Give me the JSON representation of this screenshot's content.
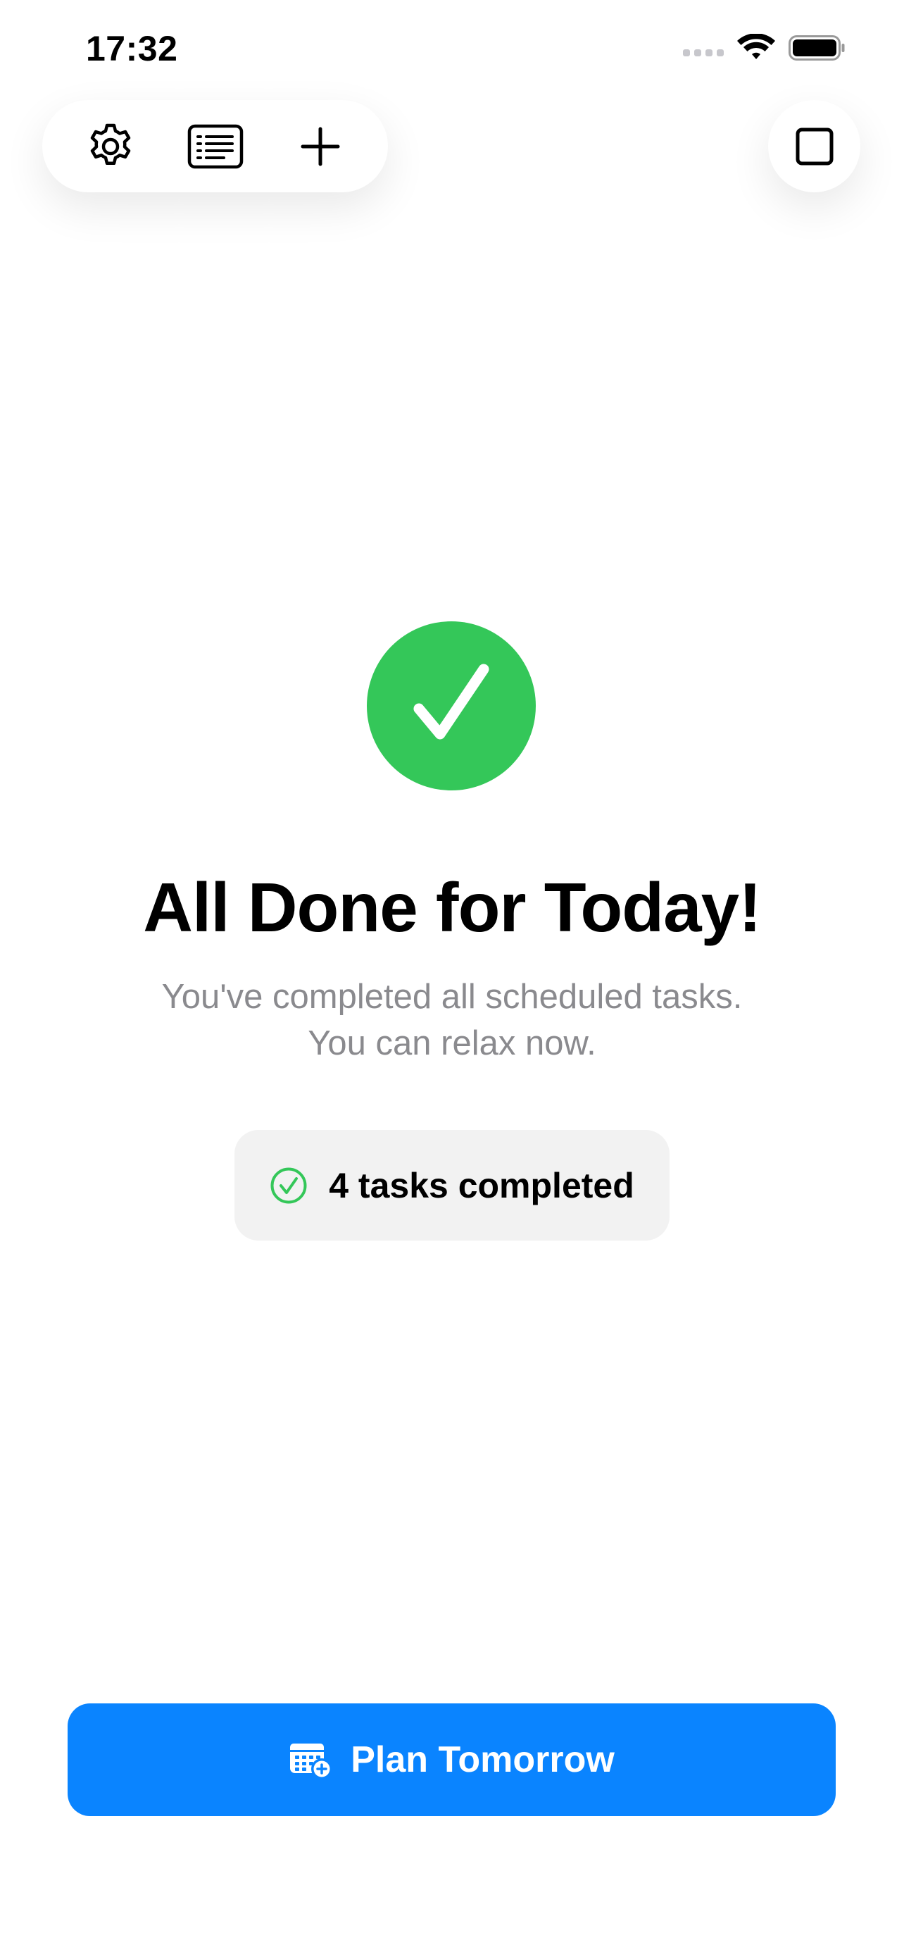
{
  "status_bar": {
    "time": "17:32"
  },
  "toolbar": {
    "buttons": [
      {
        "icon": "gear-icon"
      },
      {
        "icon": "list-icon"
      },
      {
        "icon": "plus-icon"
      }
    ],
    "right_button": {
      "icon": "square-icon"
    }
  },
  "main": {
    "badge_icon": "checkmark-icon",
    "title": "All Done for Today!",
    "subtitle_line1": "You've completed all scheduled tasks.",
    "subtitle_line2": "You can relax now.",
    "tasks_summary": "4 tasks completed"
  },
  "cta": {
    "label": "Plan Tomorrow",
    "icon": "calendar-add-icon"
  },
  "colors": {
    "accent": "#0a84ff",
    "success": "#34c759",
    "secondary_text": "#8a8a8e",
    "pill_bg": "#f2f2f2"
  }
}
